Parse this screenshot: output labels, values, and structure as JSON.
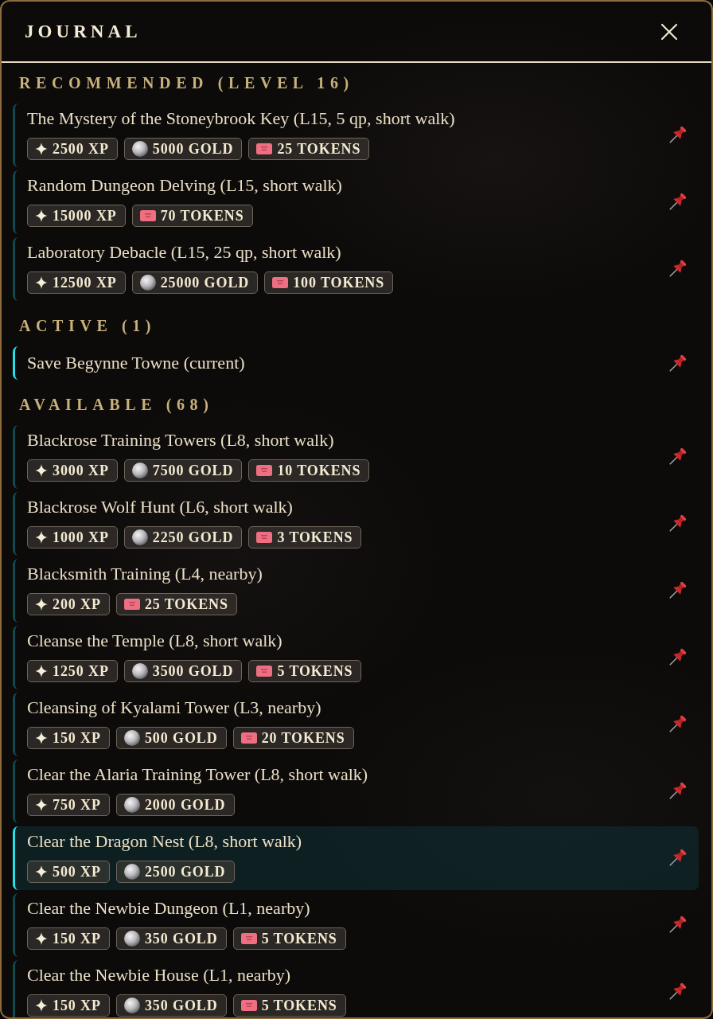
{
  "window": {
    "title": "JOURNAL"
  },
  "sections": [
    {
      "kind": "recommended",
      "heading": "RECOMMENDED (LEVEL 16)",
      "quests": [
        {
          "title": "The Mystery of the Stoneybrook Key (L15, 5 qp, short walk)",
          "selected": false,
          "rewards": [
            {
              "kind": "xp",
              "label": "2500 XP"
            },
            {
              "kind": "gold",
              "label": "5000 GOLD"
            },
            {
              "kind": "tokens",
              "label": "25 TOKENS"
            }
          ]
        },
        {
          "title": "Random Dungeon Delving (L15, short walk)",
          "selected": false,
          "rewards": [
            {
              "kind": "xp",
              "label": "15000 XP"
            },
            {
              "kind": "tokens",
              "label": "70 TOKENS"
            }
          ]
        },
        {
          "title": "Laboratory Debacle (L15, 25 qp, short walk)",
          "selected": false,
          "rewards": [
            {
              "kind": "xp",
              "label": "12500 XP"
            },
            {
              "kind": "gold",
              "label": "25000 GOLD"
            },
            {
              "kind": "tokens",
              "label": "100 TOKENS"
            }
          ]
        }
      ]
    },
    {
      "kind": "active",
      "heading": "ACTIVE (1)",
      "quests": [
        {
          "title": "Save Begynne Towne (current)",
          "selected": false
        }
      ]
    },
    {
      "kind": "available",
      "heading": "AVAILABLE (68)",
      "quests": [
        {
          "title": "Blackrose Training Towers (L8, short walk)",
          "selected": false,
          "rewards": [
            {
              "kind": "xp",
              "label": "3000 XP"
            },
            {
              "kind": "gold",
              "label": "7500 GOLD"
            },
            {
              "kind": "tokens",
              "label": "10 TOKENS"
            }
          ]
        },
        {
          "title": "Blackrose Wolf Hunt (L6, short walk)",
          "selected": false,
          "rewards": [
            {
              "kind": "xp",
              "label": "1000 XP"
            },
            {
              "kind": "gold",
              "label": "2250 GOLD"
            },
            {
              "kind": "tokens",
              "label": "3 TOKENS"
            }
          ]
        },
        {
          "title": "Blacksmith Training (L4, nearby)",
          "selected": false,
          "rewards": [
            {
              "kind": "xp",
              "label": "200 XP"
            },
            {
              "kind": "tokens",
              "label": "25 TOKENS"
            }
          ]
        },
        {
          "title": "Cleanse the Temple (L8, short walk)",
          "selected": false,
          "rewards": [
            {
              "kind": "xp",
              "label": "1250 XP"
            },
            {
              "kind": "gold",
              "label": "3500 GOLD"
            },
            {
              "kind": "tokens",
              "label": "5 TOKENS"
            }
          ]
        },
        {
          "title": "Cleansing of Kyalami Tower (L3, nearby)",
          "selected": false,
          "rewards": [
            {
              "kind": "xp",
              "label": "150 XP"
            },
            {
              "kind": "gold",
              "label": "500 GOLD"
            },
            {
              "kind": "tokens",
              "label": "20 TOKENS"
            }
          ]
        },
        {
          "title": "Clear the Alaria Training Tower (L8, short walk)",
          "selected": false,
          "rewards": [
            {
              "kind": "xp",
              "label": "750 XP"
            },
            {
              "kind": "gold",
              "label": "2000 GOLD"
            }
          ]
        },
        {
          "title": "Clear the Dragon Nest (L8, short walk)",
          "selected": true,
          "rewards": [
            {
              "kind": "xp",
              "label": "500 XP"
            },
            {
              "kind": "gold",
              "label": "2500 GOLD"
            }
          ]
        },
        {
          "title": "Clear the Newbie Dungeon (L1, nearby)",
          "selected": false,
          "rewards": [
            {
              "kind": "xp",
              "label": "150 XP"
            },
            {
              "kind": "gold",
              "label": "350 GOLD"
            },
            {
              "kind": "tokens",
              "label": "5 TOKENS"
            }
          ]
        },
        {
          "title": "Clear the Newbie House (L1, nearby)",
          "selected": false,
          "rewards": [
            {
              "kind": "xp",
              "label": "150 XP"
            },
            {
              "kind": "gold",
              "label": "350 GOLD"
            },
            {
              "kind": "tokens",
              "label": "5 TOKENS"
            }
          ]
        }
      ]
    }
  ]
}
